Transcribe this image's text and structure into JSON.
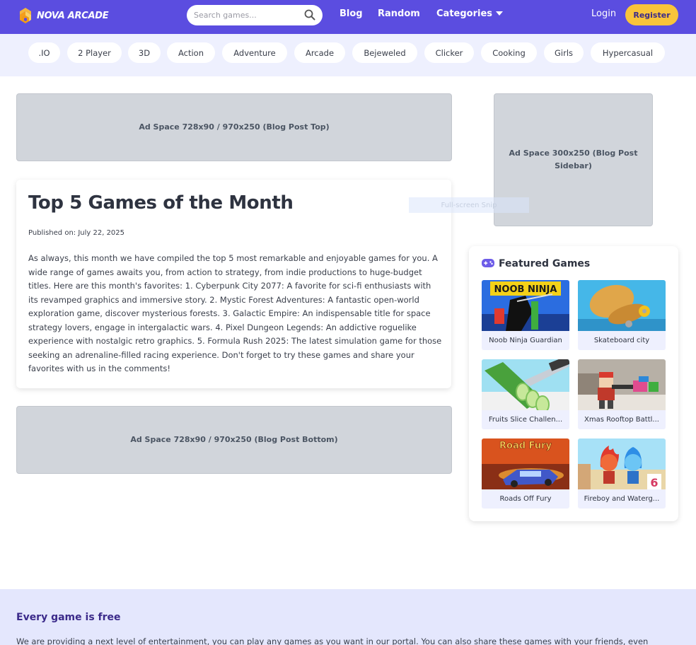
{
  "header": {
    "logo_text": "NOVA ARCADE",
    "search_placeholder": "Search games...",
    "nav": {
      "blog": "Blog",
      "random": "Random",
      "categories": "Categories"
    },
    "login": "Login",
    "register": "Register"
  },
  "categories": [
    ".IO",
    "2 Player",
    "3D",
    "Action",
    "Adventure",
    "Arcade",
    "Bejeweled",
    "Clicker",
    "Cooking",
    "Girls",
    "Hypercasual"
  ],
  "ads": {
    "top": "Ad Space 728x90 / 970x250 (Blog Post Top)",
    "sidebar": "Ad Space 300x250 (Blog Post Sidebar)",
    "bottom": "Ad Space 728x90 / 970x250 (Blog Post Bottom)"
  },
  "article": {
    "title": "Top 5 Games of the Month",
    "published": "Published on: July 22, 2025",
    "body": "As always, this month we have compiled the top 5 most remarkable and enjoyable games for you. A wide range of games awaits you, from action to strategy, from indie productions to huge-budget titles. Here are this month's favorites: 1. Cyberpunk City 2077: A favorite for sci-fi enthusiasts with its revamped graphics and immersive story. 2. Mystic Forest Adventures: A fantastic open-world exploration game, discover mysterious forests. 3. Galactic Empire: An indispensable title for space strategy lovers, engage in intergalactic wars. 4. Pixel Dungeon Legends: An addictive roguelike experience with nostalgic retro graphics. 5. Formula Rush 2025: The latest simulation game for those seeking an adrenaline-filled racing experience. Don't forget to try these games and share your favorites with us in the comments!"
  },
  "overlay_text": "Full-screen Snip",
  "featured": {
    "title": "Featured Games",
    "games": [
      {
        "name": "Noob Ninja Guardian",
        "thumb_text": "NOOB NINJA"
      },
      {
        "name": "Skateboard city"
      },
      {
        "name": "Fruits Slice Challen..."
      },
      {
        "name": "Xmas Rooftop Battl..."
      },
      {
        "name": "Roads Off Fury",
        "thumb_text": "Road Fury"
      },
      {
        "name": "Fireboy and Waterg...",
        "thumb_text": "6"
      }
    ]
  },
  "footer": {
    "title": "Every game is free",
    "text": "We are providing a next level of entertainment, you can play any games as you want in our portal. You can also share these games with your friends, even"
  },
  "colors": {
    "header_bg": "#5b4de0",
    "register_bg": "#f9c43a",
    "category_bar_bg": "#eef0fe",
    "ad_bg": "#d1d5db",
    "footer_bg": "#e4e7fd",
    "footer_title": "#3b2a8a"
  },
  "icons": {
    "logo": "nova-arcade-logo-icon",
    "search": "search-icon",
    "categories_caret": "chevron-down-icon",
    "featured": "gamepad-icon"
  }
}
